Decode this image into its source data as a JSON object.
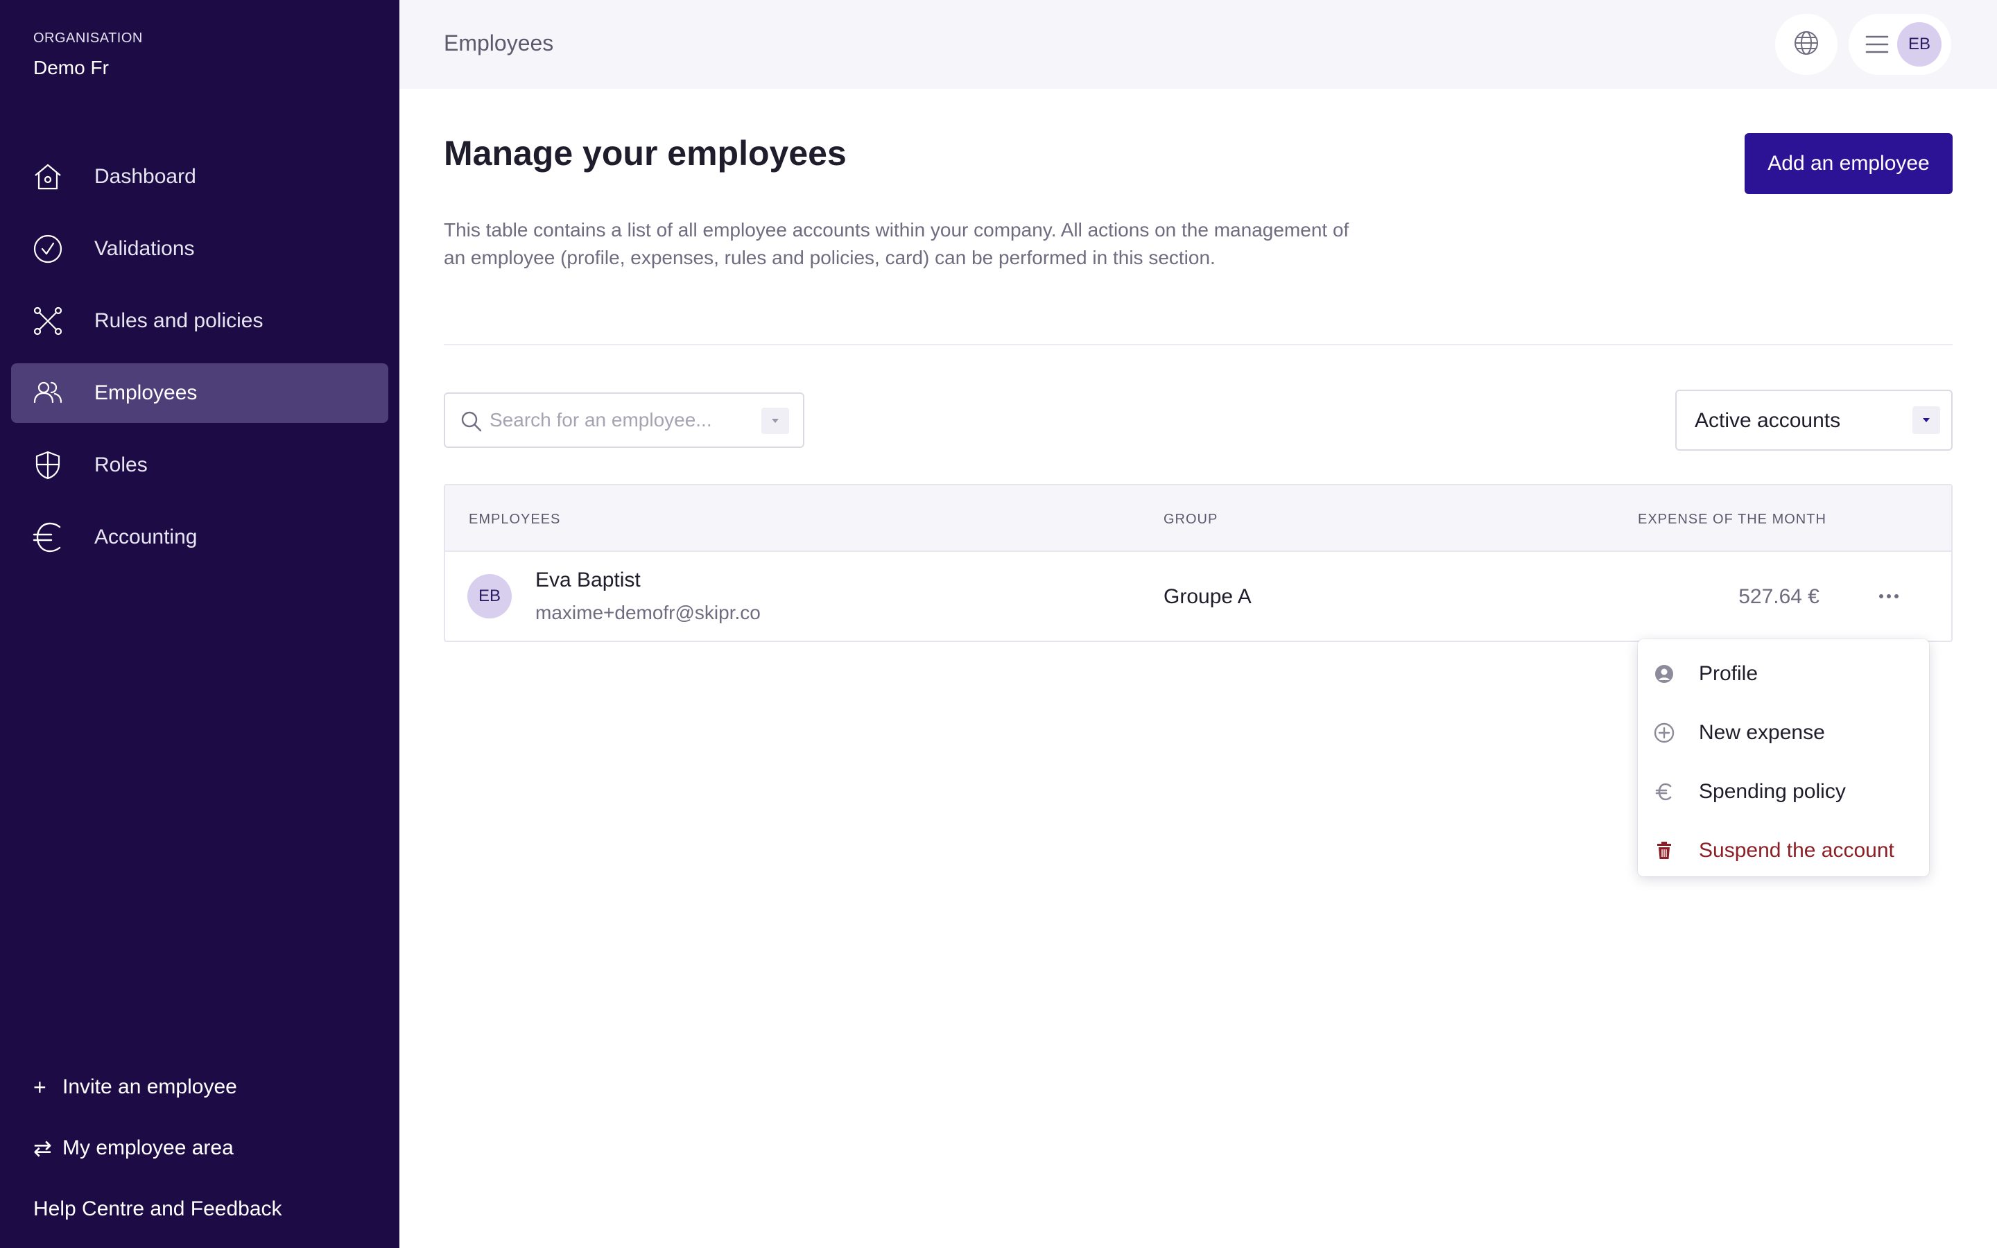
{
  "sidebar": {
    "org_label": "ORGANISATION",
    "org_name": "Demo Fr",
    "items": [
      {
        "label": "Dashboard",
        "icon": "home-icon"
      },
      {
        "label": "Validations",
        "icon": "check-circle-icon"
      },
      {
        "label": "Rules and policies",
        "icon": "network-icon"
      },
      {
        "label": "Employees",
        "icon": "users-icon",
        "active": true
      },
      {
        "label": "Roles",
        "icon": "shield-icon"
      },
      {
        "label": "Accounting",
        "icon": "euro-icon"
      }
    ],
    "bottom_links": {
      "invite": "Invite an employee",
      "employee_area": "My employee area",
      "help": "Help Centre and Feedback"
    }
  },
  "header": {
    "title": "Employees",
    "user_initials": "EB"
  },
  "main": {
    "title": "Manage your employees",
    "add_button": "Add an employee",
    "description": "This table contains a list of all employee accounts within your company. All actions on the management of an employee (profile, expenses, rules and policies, card) can be performed in this section.",
    "search_placeholder": "Search for an employee...",
    "status_filter": "Active accounts"
  },
  "table": {
    "columns": {
      "employees": "EMPLOYEES",
      "group": "GROUP",
      "expense": "EXPENSE OF THE MONTH"
    },
    "rows": [
      {
        "initials": "EB",
        "name": "Eva Baptist",
        "email": "maxime+demofr@skipr.co",
        "group": "Groupe A",
        "expense": "527.64 €"
      }
    ]
  },
  "row_menu": {
    "profile": "Profile",
    "new_expense": "New expense",
    "spending_policy": "Spending policy",
    "suspend": "Suspend the account"
  },
  "colors": {
    "sidebar_bg": "#1d0b45",
    "sidebar_active": "#4e3f79",
    "primary": "#2c1396",
    "danger": "#8b1f25",
    "avatar_bg": "#d8cfee"
  }
}
